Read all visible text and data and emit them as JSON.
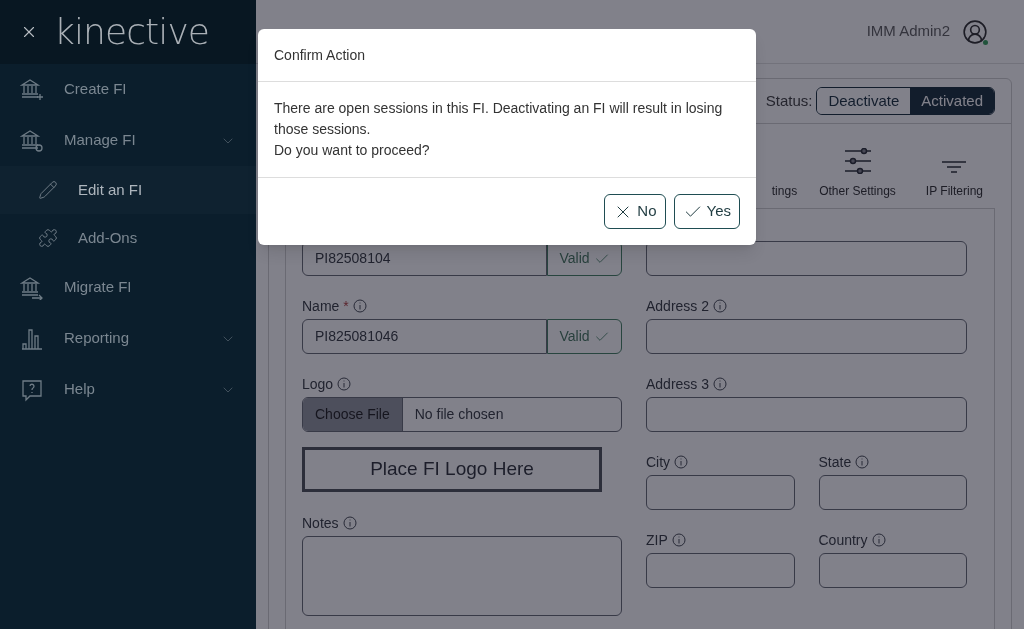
{
  "sidebar": {
    "logo": "kinective",
    "items": [
      {
        "label": "Create FI",
        "kind": "link",
        "selected": false
      },
      {
        "label": "Manage FI",
        "kind": "group",
        "selected": false,
        "expanded": true,
        "children": [
          {
            "label": "Edit an FI",
            "selected": true
          },
          {
            "label": "Add-Ons",
            "selected": false
          }
        ]
      },
      {
        "label": "Migrate FI",
        "kind": "link",
        "selected": false
      },
      {
        "label": "Reporting",
        "kind": "group",
        "selected": false
      },
      {
        "label": "Help",
        "kind": "group",
        "selected": false
      }
    ]
  },
  "header": {
    "user": "IMM Admin2",
    "online": true
  },
  "status": {
    "label": "Status:",
    "options": [
      {
        "label": "Deactivate",
        "selected": false
      },
      {
        "label": "Activated",
        "selected": true
      }
    ]
  },
  "tabs": [
    {
      "label": "tings",
      "selected": false
    },
    {
      "label": "Other Settings",
      "selected": false
    },
    {
      "label": "IP Filtering",
      "selected": false
    }
  ],
  "form": {
    "left": [
      {
        "kind": "validated",
        "value": "PI82508104",
        "status": "Valid"
      },
      {
        "kind": "validated",
        "label": "Name",
        "required_mark": "*",
        "value": "PI825081046",
        "status": "Valid"
      },
      {
        "kind": "file",
        "label": "Logo",
        "button": "Choose File",
        "value": "No file chosen"
      },
      {
        "kind": "logo_box",
        "text": "Place FI Logo Here"
      },
      {
        "kind": "textarea",
        "label": "Notes"
      }
    ],
    "right": [
      [
        {
          "kind": "text"
        }
      ],
      [
        {
          "kind": "text",
          "label": "Address 2"
        }
      ],
      [
        {
          "kind": "text",
          "label": "Address 3"
        }
      ],
      [
        {
          "kind": "text",
          "label": "City"
        },
        {
          "kind": "text",
          "label": "State"
        }
      ],
      [
        {
          "kind": "text",
          "label": "ZIP"
        },
        {
          "kind": "text",
          "label": "Country"
        }
      ]
    ]
  },
  "dialog": {
    "title": "Confirm Action",
    "message": [
      "There are open sessions in this FI. Deactivating an FI will result in losing those sessions.",
      "Do you want to proceed?"
    ],
    "buttons": [
      {
        "label": "No",
        "kind": "cancel"
      },
      {
        "label": "Yes",
        "kind": "confirm"
      }
    ]
  }
}
